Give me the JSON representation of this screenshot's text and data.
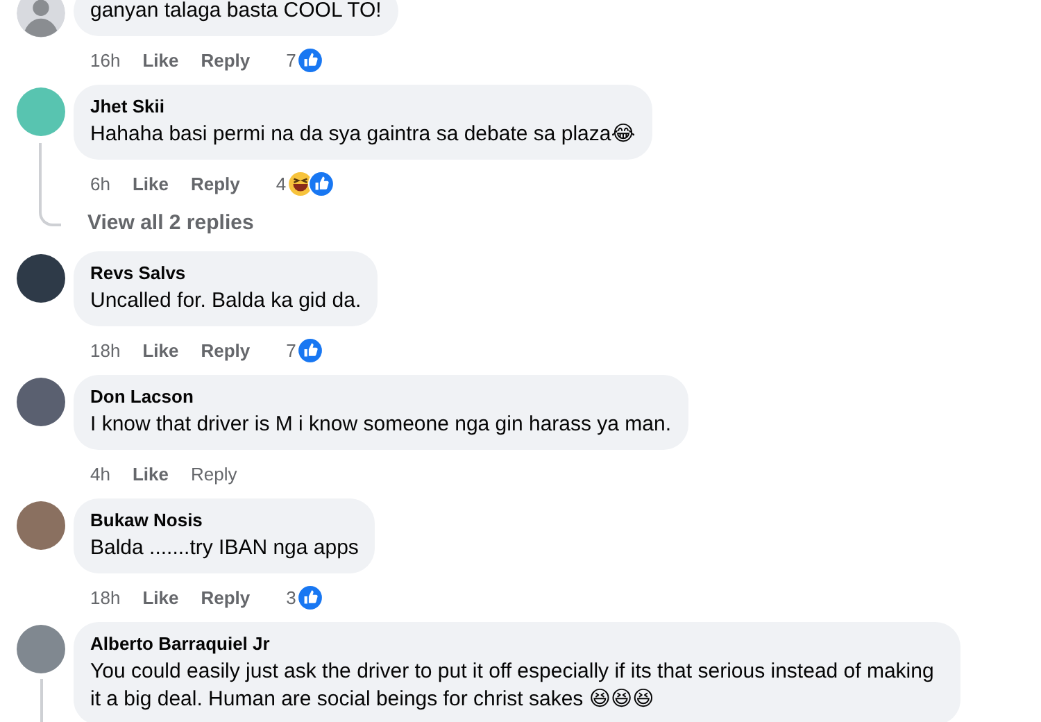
{
  "comments": [
    {
      "text": "ganyan talaga basta COOL TO!",
      "time": "16h",
      "actions": [
        "Like",
        "Reply"
      ],
      "reaction_count": "7",
      "reactions": [
        {
          "kind": "like"
        }
      ],
      "thread": false,
      "avatar": {
        "kind": "silhouette"
      }
    },
    {
      "author": "Jhet Skii",
      "text": "Hahaha basi permi na da sya gaintra sa debate sa plaza😂",
      "time": "6h",
      "actions": [
        "Like",
        "Reply"
      ],
      "reaction_count": "4",
      "reactions": [
        {
          "kind": "haha"
        },
        {
          "kind": "like"
        }
      ],
      "thread": true,
      "view_replies": "View all 2 replies",
      "avatar": {
        "kind": "photo"
      }
    },
    {
      "author": "Revs Salvs",
      "text": "Uncalled for. Balda ka gid da.",
      "time": "18h",
      "actions": [
        "Like",
        "Reply"
      ],
      "reaction_count": "7",
      "reactions": [
        {
          "kind": "like"
        }
      ],
      "thread": false,
      "avatar": {
        "kind": "photo"
      }
    },
    {
      "author": "Don Lacson",
      "text": "I know that driver is M i know someone nga gin harass ya man.",
      "time": "4h",
      "actions": [
        "Like",
        "Reply"
      ],
      "thread": false,
      "avatar": {
        "kind": "photo"
      }
    },
    {
      "author": "Bukaw Nosis",
      "text": "Balda .......try IBAN nga apps",
      "time": "18h",
      "actions": [
        "Like",
        "Reply"
      ],
      "reaction_count": "3",
      "reactions": [
        {
          "kind": "like"
        }
      ],
      "thread": false,
      "avatar": {
        "kind": "photo"
      }
    },
    {
      "author": "Alberto Barraquiel Jr",
      "text": "You could easily just ask the driver to put it off especially if its that serious instead of making it a big deal. Human are social beings for christ sakes 😆😆😆",
      "thread": true,
      "avatar": {
        "kind": "photo"
      }
    }
  ]
}
